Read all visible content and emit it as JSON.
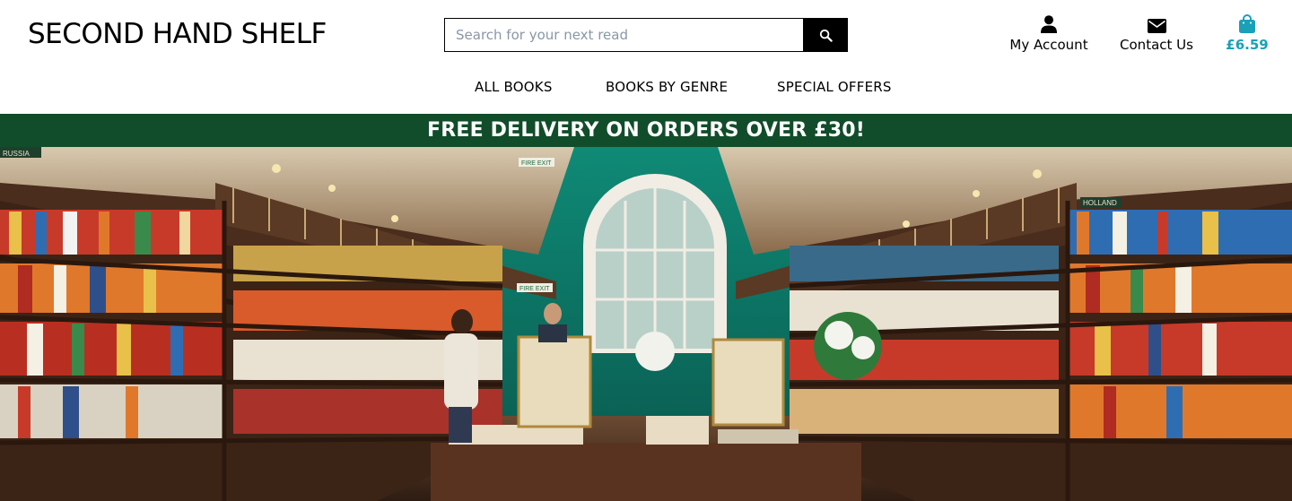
{
  "header": {
    "logo": "SECOND HAND SHELF",
    "search": {
      "placeholder": "Search for your next read",
      "value": ""
    },
    "account_label": "My Account",
    "contact_label": "Contact Us",
    "bag_total": "£6.59"
  },
  "nav": {
    "items": [
      "ALL BOOKS",
      "BOOKS BY GENRE",
      "SPECIAL OFFERS"
    ]
  },
  "banner": {
    "text": "FREE DELIVERY ON ORDERS OVER £30!"
  },
  "hero": {
    "signs": [
      "RUSSIA",
      "FIRE EXIT",
      "FIRE EXIT",
      "HOLLAND"
    ]
  },
  "colors": {
    "banner_bg": "#114d2a",
    "bag_accent": "#1aa0b8",
    "search_button": "#000000"
  },
  "icons": [
    "search-icon",
    "user-icon",
    "envelope-icon",
    "shopping-bag-icon"
  ]
}
